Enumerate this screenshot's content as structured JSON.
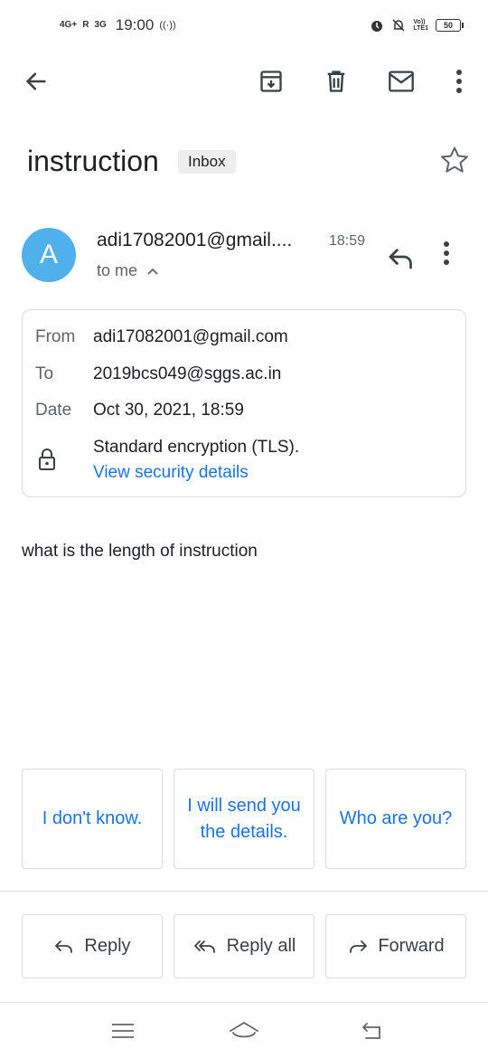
{
  "status_bar": {
    "net1": "4G+",
    "roaming": "R",
    "net2": "3G",
    "time": "19:00",
    "volte": "Vo))\nLTE1",
    "battery": "50"
  },
  "toolbar": {
    "back_icon": "arrow-left-icon",
    "archive_icon": "archive-icon",
    "delete_icon": "trash-icon",
    "mark_unread_icon": "mail-icon",
    "more_icon": "more-vert-icon"
  },
  "message": {
    "subject": "instruction",
    "label": "Inbox",
    "avatar_letter": "A",
    "sender": "adi17082001@gmail....",
    "time": "18:59",
    "to_line": "to me",
    "details": {
      "from_label": "From",
      "from_value": "adi17082001@gmail.com",
      "to_label": "To",
      "to_value": "2019bcs049@sggs.ac.in",
      "date_label": "Date",
      "date_value": "Oct 30, 2021, 18:59",
      "encryption": "Standard encryption (TLS).",
      "security_link": "View security details"
    },
    "body": "what is the length of instruction"
  },
  "smart_replies": [
    "I don't know.",
    "I will send you the details.",
    "Who are you?"
  ],
  "actions": {
    "reply": "Reply",
    "reply_all": "Reply all",
    "forward": "Forward"
  },
  "colors": {
    "accent": "#1a73e8",
    "avatar": "#4fb0ec",
    "border": "#dadce0",
    "secondary_text": "#5f6368"
  }
}
